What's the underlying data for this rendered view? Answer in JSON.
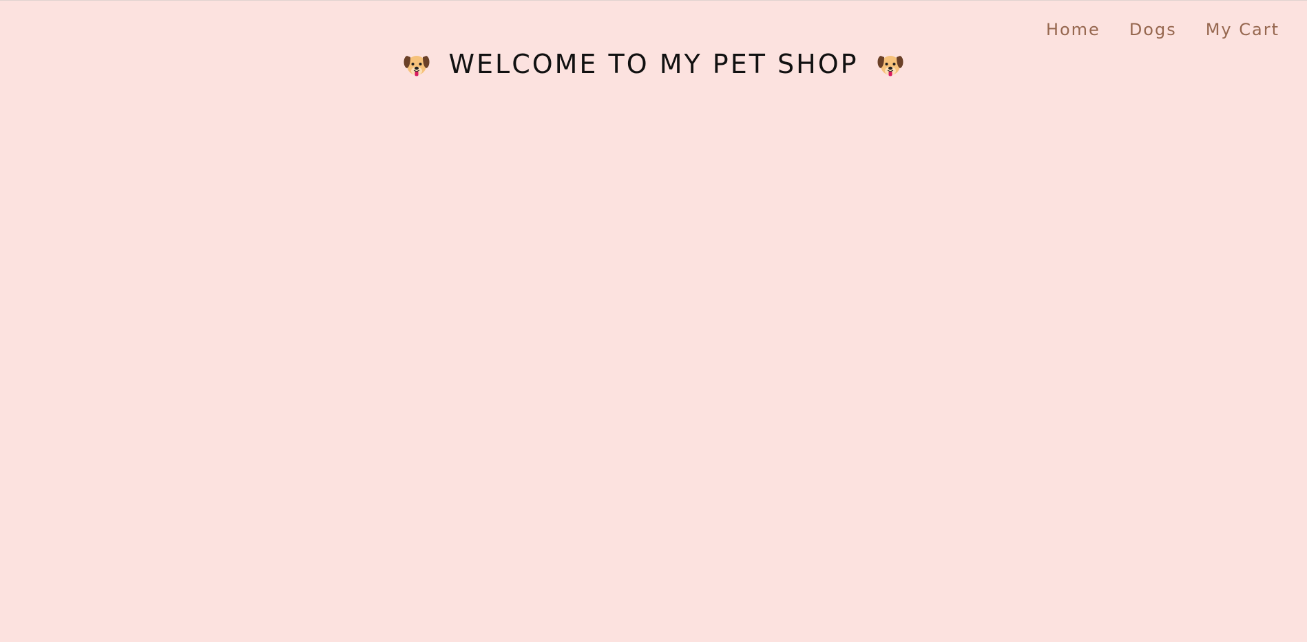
{
  "nav": {
    "items": [
      {
        "label": "Home"
      },
      {
        "label": "Dogs"
      },
      {
        "label": "My Cart"
      }
    ]
  },
  "header": {
    "title": "WELCOME TO MY PET SHOP",
    "left_icon": "dog-face-icon",
    "right_icon": "dog-face-icon"
  },
  "colors": {
    "background": "#fce2df",
    "nav_link": "#96674f",
    "title": "#111111"
  }
}
